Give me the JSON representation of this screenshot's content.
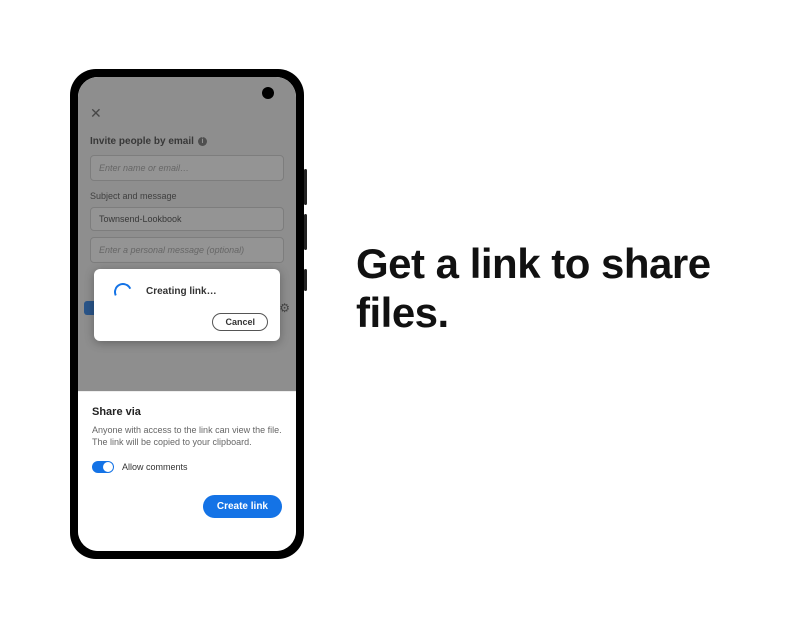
{
  "headline": "Get a link to share files.",
  "invite": {
    "title": "Invite people by email",
    "name_placeholder": "Enter name or email…",
    "subject_label": "Subject and message",
    "subject_value": "Townsend-Lookbook",
    "message_placeholder": "Enter a personal message (optional)"
  },
  "modal": {
    "status": "Creating link…",
    "cancel": "Cancel"
  },
  "sheet": {
    "title": "Share via",
    "desc": "Anyone with access to the link can view the file. The link will be copied to your clipboard.",
    "allow_comments": "Allow comments",
    "create": "Create link"
  },
  "colors": {
    "accent": "#1473e6"
  }
}
